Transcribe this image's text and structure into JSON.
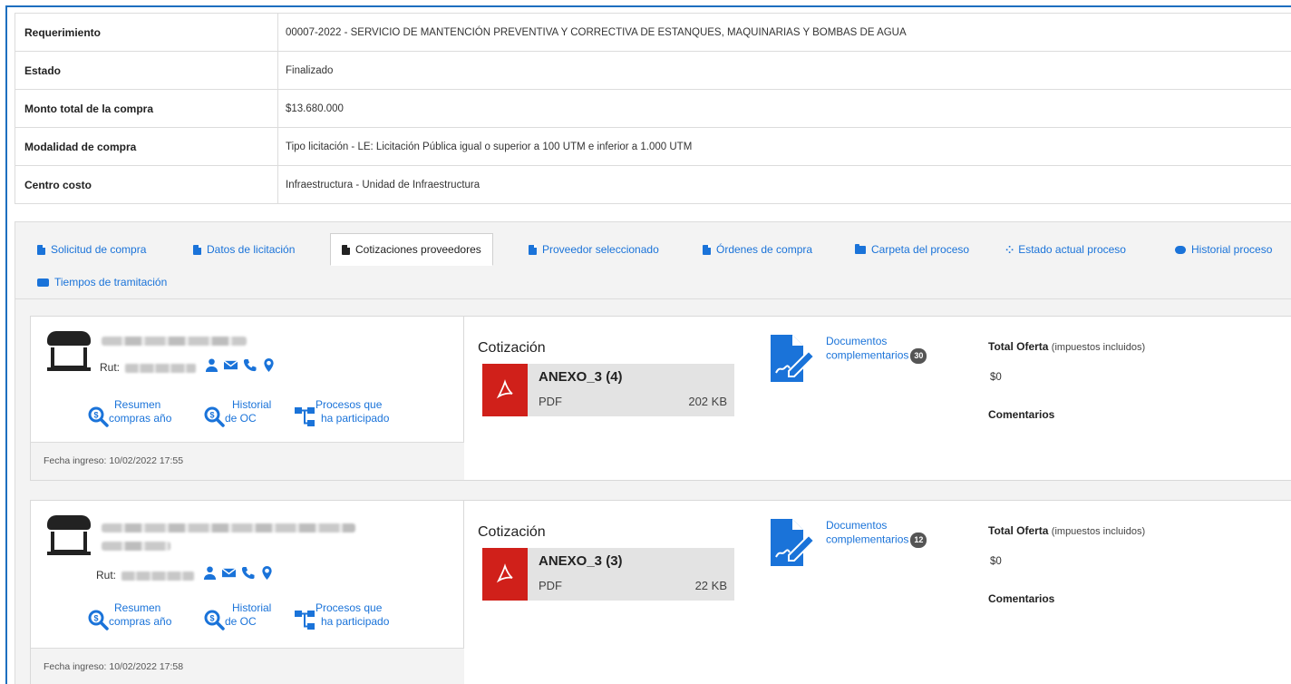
{
  "info": [
    {
      "label": "Requerimiento",
      "value": "00007-2022 - SERVICIO DE MANTENCIÓN PREVENTIVA Y CORRECTIVA DE ESTANQUES, MAQUINARIAS Y BOMBAS DE AGUA"
    },
    {
      "label": "Estado",
      "value": "Finalizado"
    },
    {
      "label": "Monto total de la compra",
      "value": "$13.680.000"
    },
    {
      "label": "Modalidad de compra",
      "value": "Tipo licitación - LE: Licitación Pública igual o superior a 100 UTM e inferior a 1.000 UTM"
    },
    {
      "label": "Centro costo",
      "value": "Infraestructura - Unidad de Infraestructura"
    }
  ],
  "tabs": [
    {
      "label": "Solicitud de compra",
      "icon": "document-icon"
    },
    {
      "label": "Datos de licitación",
      "icon": "document-icon"
    },
    {
      "label": "Cotizaciones proveedores",
      "icon": "document-icon",
      "active": true
    },
    {
      "label": "Proveedor seleccionado",
      "icon": "document-icon"
    },
    {
      "label": "Órdenes de compra",
      "icon": "document-icon"
    },
    {
      "label": "Carpeta del proceso",
      "icon": "folder-icon"
    },
    {
      "label": "Estado actual proceso",
      "icon": "project-diagram-icon"
    },
    {
      "label": "Historial proceso",
      "icon": "comments-icon"
    },
    {
      "label": "Tiempos de tramitación",
      "icon": "truck-icon"
    }
  ],
  "suppliers": [
    {
      "rut_label": "Rut:",
      "links": {
        "resumen_1": "Resumen",
        "resumen_2": "compras año",
        "historial_1": "Historial",
        "historial_2": "de OC",
        "procesos_1": "Procesos que",
        "procesos_2": "ha participado"
      },
      "fecha": "Fecha ingreso: 10/02/2022 17:55",
      "cotizacion_title": "Cotización",
      "file": {
        "name": "ANEXO_3 (4)",
        "type": "PDF",
        "size": "202 KB"
      },
      "docs_1": "Documentos",
      "docs_2": "complementarios",
      "docs_count": "30",
      "total_label": "Total Oferta",
      "total_note": "(impuestos incluidos)",
      "total_value": "$0",
      "comentarios": "Comentarios"
    },
    {
      "rut_label": "Rut:",
      "links": {
        "resumen_1": "Resumen",
        "resumen_2": "compras año",
        "historial_1": "Historial",
        "historial_2": "de OC",
        "procesos_1": "Procesos que",
        "procesos_2": "ha participado"
      },
      "fecha": "Fecha ingreso: 10/02/2022 17:58",
      "cotizacion_title": "Cotización",
      "file": {
        "name": "ANEXO_3 (3)",
        "type": "PDF",
        "size": "22 KB"
      },
      "docs_1": "Documentos",
      "docs_2": "complementarios",
      "docs_count": "12",
      "total_label": "Total Oferta",
      "total_note": "(impuestos incluidos)",
      "total_value": "$0",
      "comentarios": "Comentarios"
    }
  ],
  "colors": {
    "link": "#1a73d9",
    "pdf_red": "#d0201a",
    "border": "#1e6fbf"
  }
}
